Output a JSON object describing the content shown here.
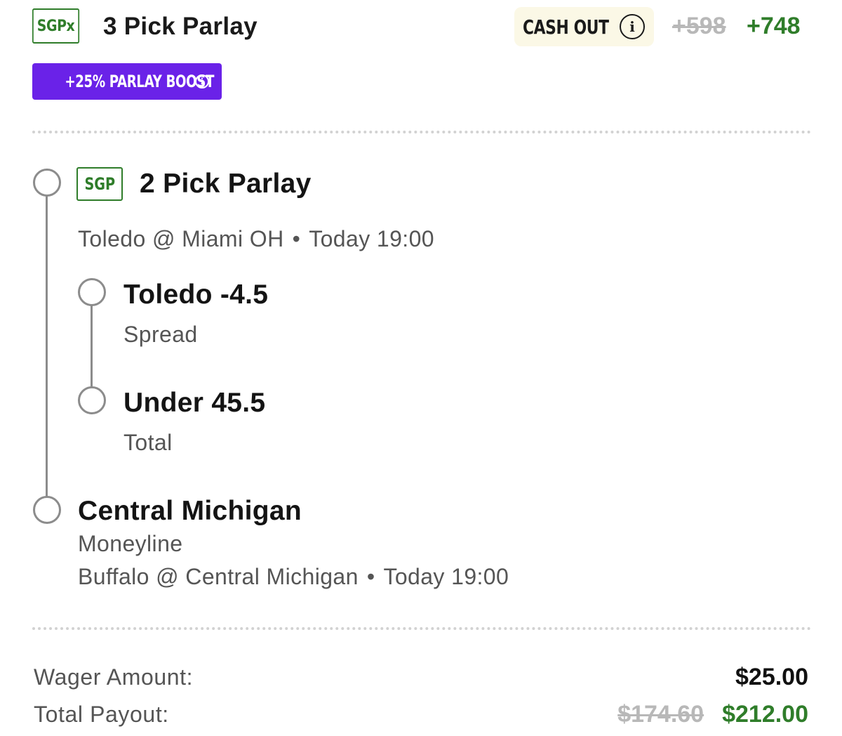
{
  "header": {
    "badge": "SGPx",
    "title": "3 Pick Parlay",
    "cash_out_label": "CASH OUT",
    "info_glyph": "i",
    "odds_original": "+598",
    "odds_boosted": "+748"
  },
  "boost": {
    "label": "+25% PARLAY BOOST",
    "info_glyph": "i"
  },
  "sgp_parlay": {
    "badge": "SGP",
    "title": "2 Pick Parlay",
    "matchup": "Toledo @ Miami OH",
    "separator": "•",
    "time": "Today 19:00",
    "legs": [
      {
        "selection": "Toledo -4.5",
        "market": "Spread"
      },
      {
        "selection": "Under 45.5",
        "market": "Total"
      }
    ]
  },
  "straight_leg": {
    "selection": "Central Michigan",
    "market": "Moneyline",
    "matchup": "Buffalo @ Central Michigan",
    "separator": "•",
    "time": "Today 19:00"
  },
  "footer": {
    "wager_label": "Wager Amount:",
    "wager_value": "$25.00",
    "payout_label": "Total Payout:",
    "payout_original": "$174.60",
    "payout_boosted": "$212.00"
  },
  "colors": {
    "accent_green": "#2f7d2a",
    "boost_purple": "#6a22e8",
    "cash_out_bg": "#fbf8e6",
    "timeline_gray": "#8c8c8c"
  }
}
